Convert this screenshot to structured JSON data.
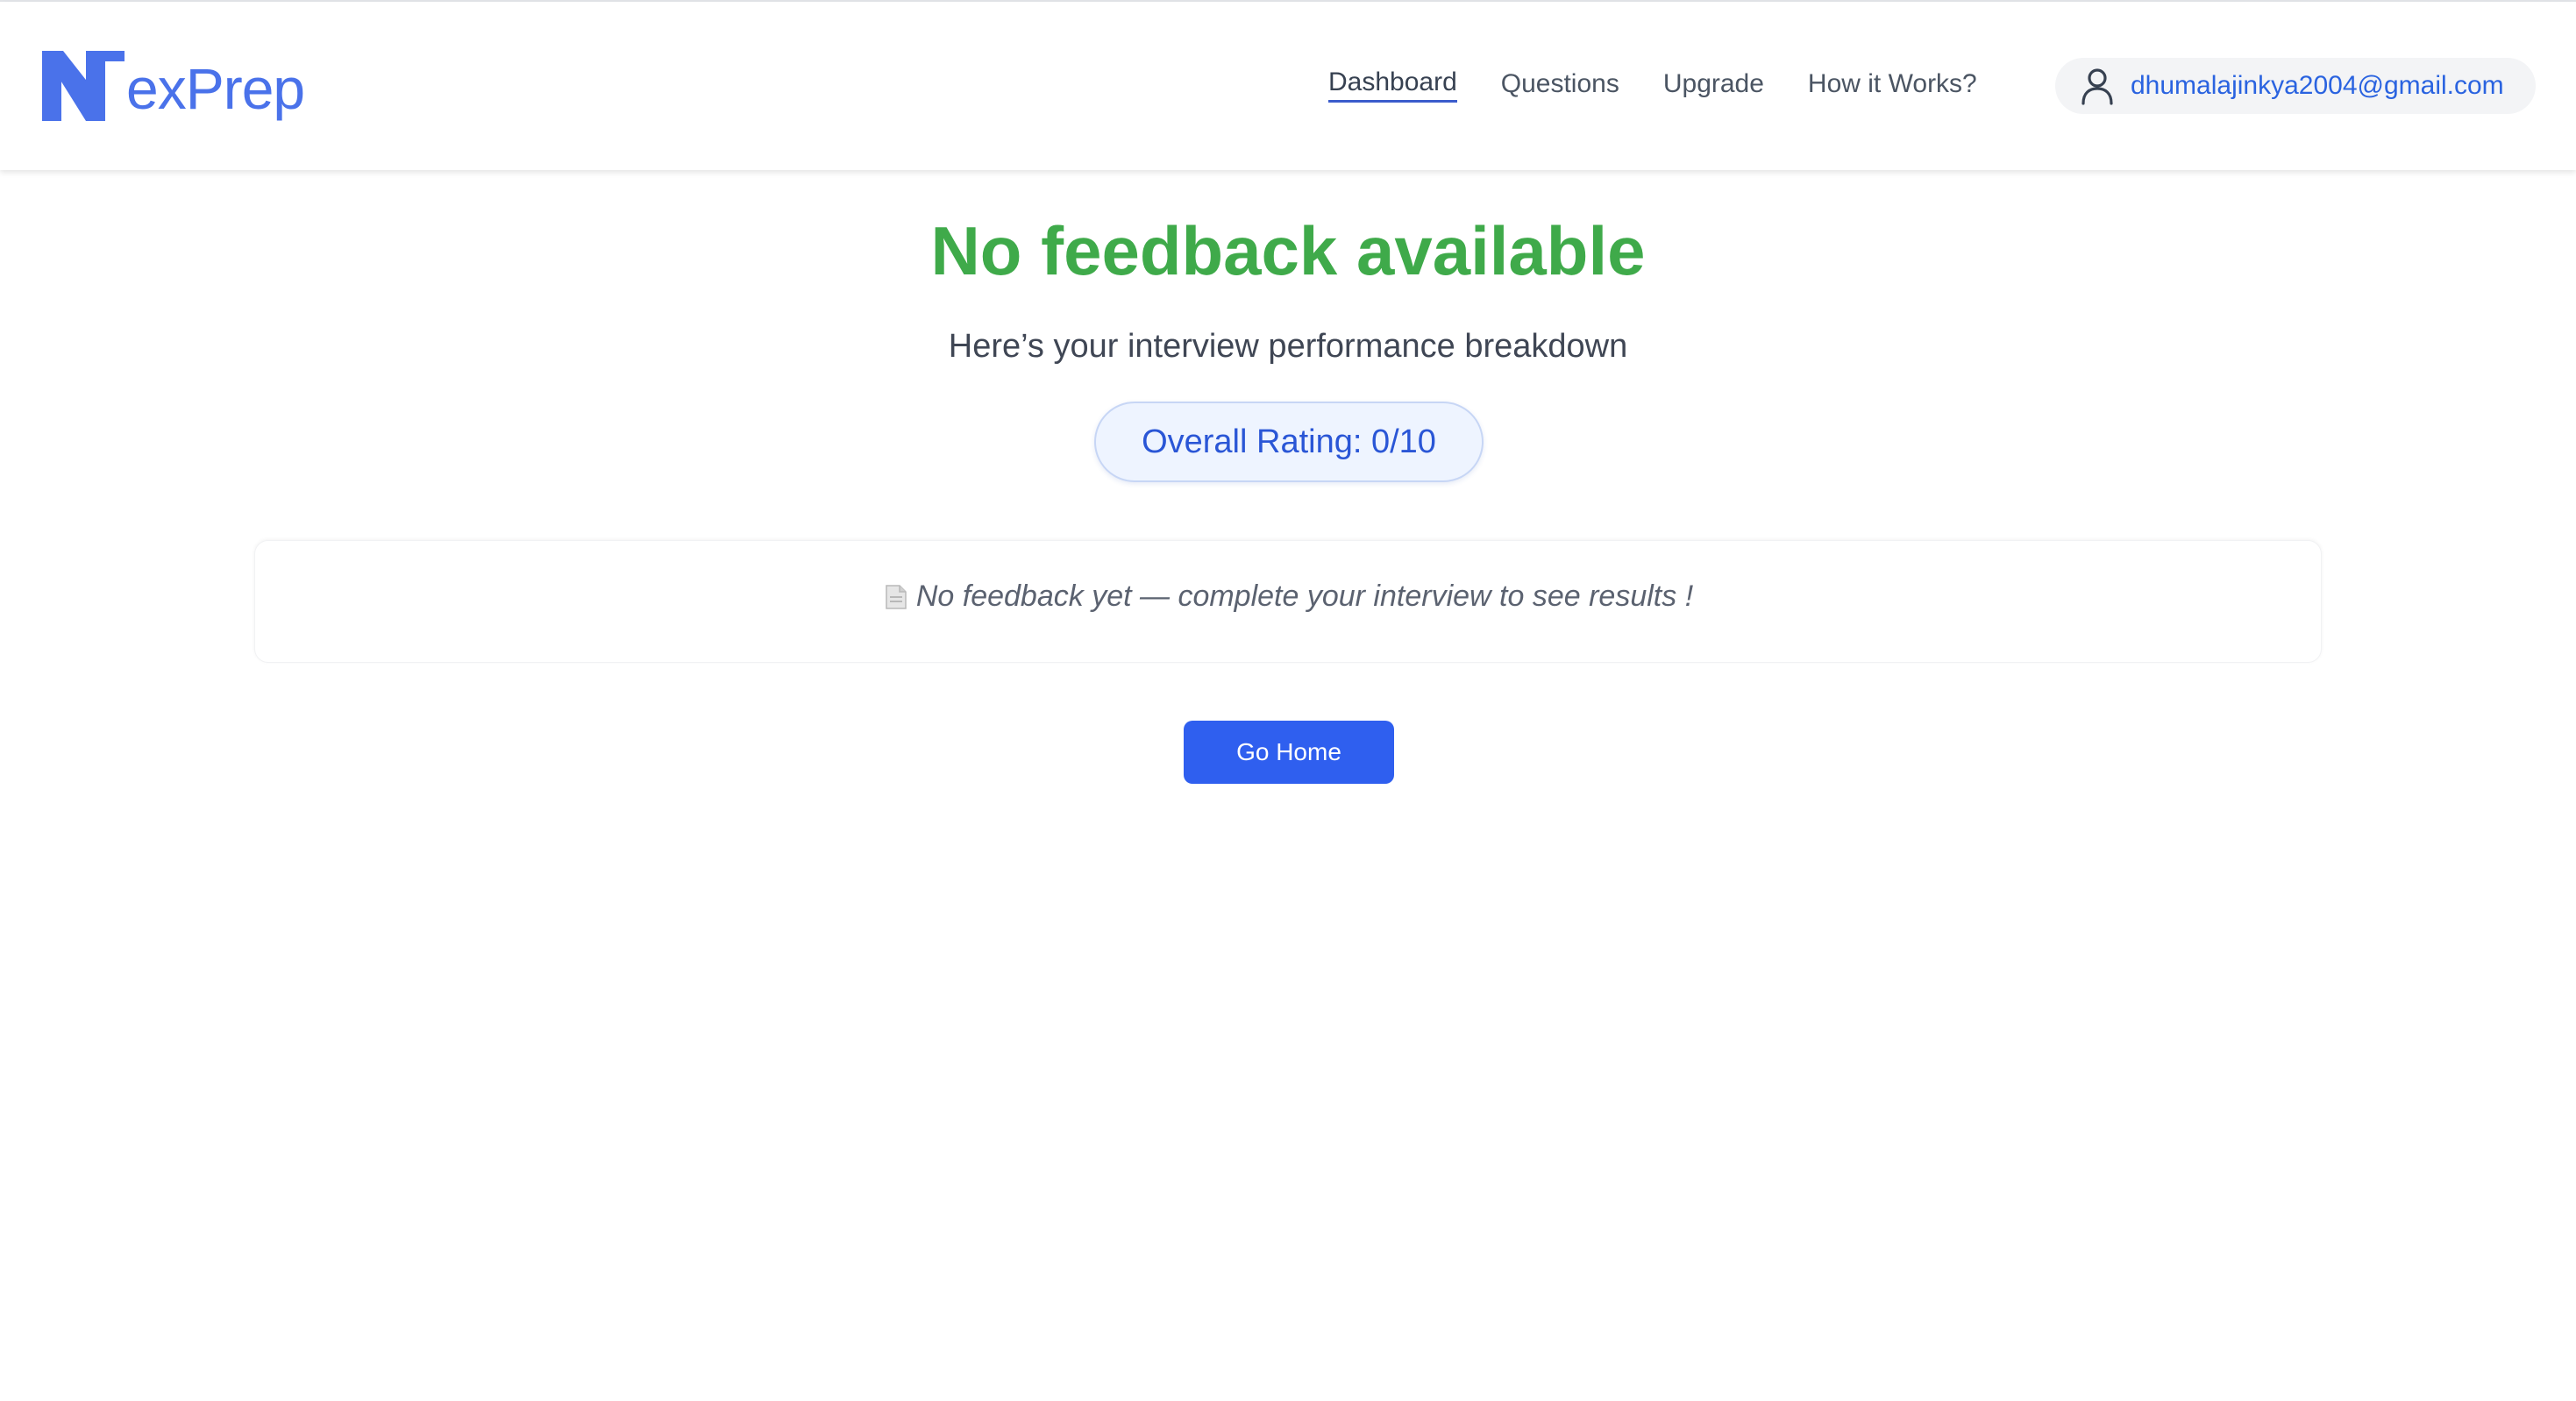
{
  "brand": {
    "logo_text": "exPrep",
    "logo_mark": "N",
    "color": "#4a72ea"
  },
  "nav": {
    "items": [
      {
        "label": "Dashboard",
        "active": true
      },
      {
        "label": "Questions",
        "active": false
      },
      {
        "label": "Upgrade",
        "active": false
      },
      {
        "label": "How it Works?",
        "active": false
      }
    ]
  },
  "user": {
    "icon": "user-icon",
    "email": "dhumalajinkya2004@gmail.com"
  },
  "main": {
    "title": "No feedback available",
    "subtitle": "Here’s your interview performance breakdown",
    "rating_label": "Overall Rating: 0/10",
    "feedback_icon": "document-icon",
    "feedback_message": "No feedback yet — complete your interview to see results !",
    "go_home_label": "Go Home"
  },
  "colors": {
    "title_green": "#3faa4a",
    "accent_blue": "#2f5fef",
    "rating_blue": "#2a56d6"
  }
}
